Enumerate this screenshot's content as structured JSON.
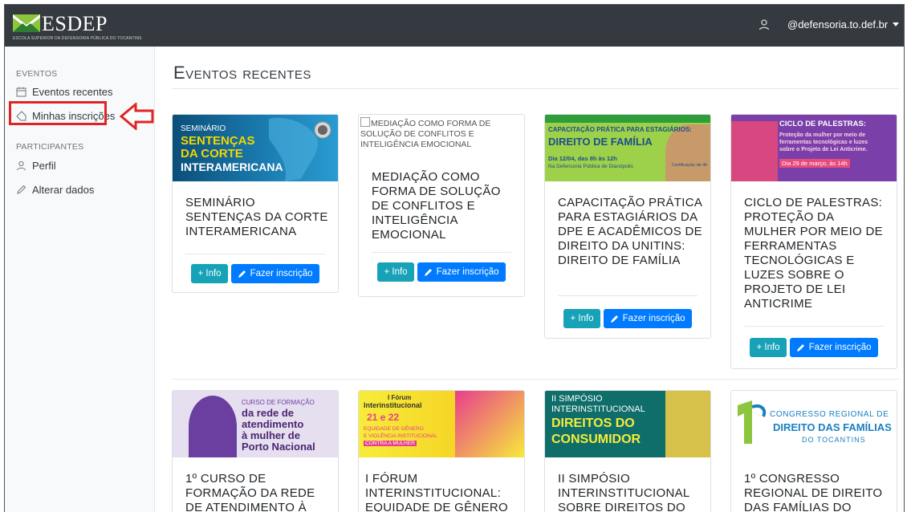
{
  "navbar": {
    "brand": "ESDEP",
    "brand_subtitle": "ESCOLA SUPERIOR DA DEFENSORIA PÚBLICA DO TOCANTINS",
    "user_email": "@defensoria.to.def.br"
  },
  "sidebar": {
    "section_events": "EVENTOS",
    "item_recent": "Eventos recentes",
    "item_subscriptions": "Minhas inscrições",
    "section_participants": "PARTICIPANTES",
    "item_profile": "Perfil",
    "item_change": "Alterar dados"
  },
  "main": {
    "title": "Eventos recentes"
  },
  "buttons": {
    "info": "+ Info",
    "subscribe": "Fazer inscrição"
  },
  "cards": [
    {
      "title": "SEMINÁRIO SENTENÇAS DA CORTE INTERAMERICANA",
      "img": {
        "l1": "SEMINÁRIO",
        "l2": "SENTENÇAS",
        "l3": "DA CORTE",
        "l4": "INTERAMERICANA"
      }
    },
    {
      "title": "MEDIAÇÃO COMO FORMA DE SOLUÇÃO DE CONFLITOS E INTELIGÊNCIA EMOCIONAL",
      "img_alt": "MEDIAÇÃO COMO FORMA DE SOLUÇÃO DE CONFLITOS E INTELIGÊNCIA EMOCIONAL"
    },
    {
      "title": "CAPACITAÇÃO PRÁTICA PARA ESTAGIÁRIOS DA DPE E ACADÊMICOS DE DIREITO DA UNITINS: DIREITO DE FAMÍLIA",
      "img": {
        "l1": "CAPACITAÇÃO PRÁTICA PARA ESTAGIÁRIOS:",
        "l2": "DIREITO DE FAMÍLIA",
        "l3": "Dia 12/04, das 8h às 12h",
        "l4": "Na Defensoria Pública de Dianópolis",
        "l5": "Certificação de 4h"
      }
    },
    {
      "title": "CICLO DE PALESTRAS: PROTEÇÃO DA MULHER POR MEIO DE FERRAMENTAS TECNOLÓGICAS E LUZES SOBRE O PROJETO DE LEI ANTICRIME",
      "img": {
        "l1": "CICLO DE PALESTRAS:",
        "l2": "Proteção da mulher por meio de",
        "l3": "ferramentas tecnológicas e luzes",
        "l4": "sobre o Projeto de Lei Anticrime.",
        "l5": "Dia 29 de março, às 14h"
      }
    },
    {
      "title": "1º CURSO DE FORMAÇÃO DA REDE DE ATENDIMENTO À",
      "img": {
        "l1": "CURSO DE FORMAÇÃO",
        "l2": "da rede de",
        "l3": "atendimento",
        "l4": "à mulher de",
        "l5": "Porto Nacional"
      }
    },
    {
      "title": "I FÓRUM INTERINSTITUCIONAL: EQUIDADE DE GÊNERO",
      "img": {
        "l1": "I Fórum",
        "l2": "Interinstitucional",
        "l3": "21 e 22",
        "l4": "EQUIDADE DE GÊNERO",
        "l5": "E VIOLÊNCIA INSTITUCIONAL",
        "l6": "CONTRA A MULHER"
      }
    },
    {
      "title": "II SIMPÓSIO INTERINSTITUCIONAL SOBRE DIREITOS DO",
      "img": {
        "l1": "II SIMPÓSIO",
        "l2": "INTERINSTITUCIONAL",
        "l3": "DIREITOS DO",
        "l4": "CONSUMIDOR"
      }
    },
    {
      "title": "1º CONGRESSO REGIONAL DE DIREITO DAS FAMÍLIAS DO",
      "img": {
        "l1": "CONGRESSO REGIONAL DE",
        "l2": "DIREITO DAS FAMÍLIAS",
        "l3": "DO TOCANTINS"
      }
    }
  ],
  "colors": {
    "navbar": "#343a40",
    "info_button": "#17a2b8",
    "primary_button": "#007bff",
    "highlight": "#e02424"
  }
}
